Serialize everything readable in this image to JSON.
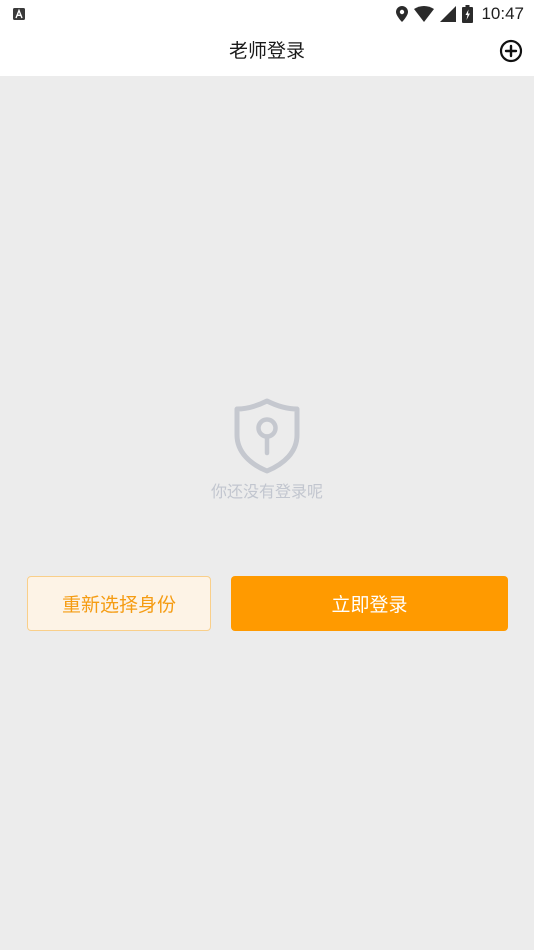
{
  "status_bar": {
    "time": "10:47",
    "icons": [
      "notification-a-icon",
      "location-icon",
      "wifi-icon",
      "signal-icon",
      "battery-icon"
    ]
  },
  "header": {
    "title": "老师登录",
    "action_icon": "add-circle-icon"
  },
  "empty_state": {
    "icon": "shield-lock-icon",
    "message": "你还没有登录呢"
  },
  "actions": {
    "reselect_label": "重新选择身份",
    "login_label": "立即登录"
  },
  "colors": {
    "accent": "#ff9a00",
    "accent_light_bg": "#fdf3e6",
    "accent_border": "#f9cf8a",
    "muted_text": "#c2c6cf",
    "page_bg": "#ececec"
  }
}
